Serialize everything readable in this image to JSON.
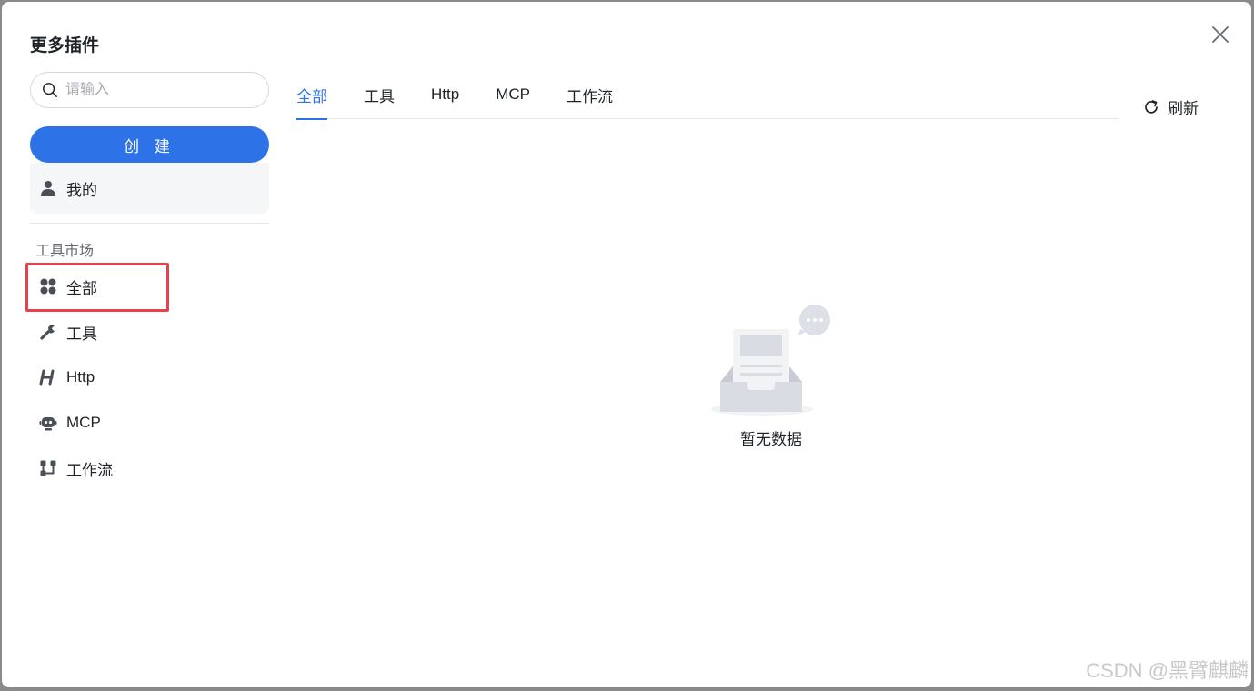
{
  "dialog": {
    "title": "更多插件"
  },
  "sidebar": {
    "search_placeholder": "请输入",
    "create_label": "创 建",
    "mine_label": "我的",
    "section_label": "工具市场",
    "items": [
      {
        "label": "全部",
        "icon": "grid-icon"
      },
      {
        "label": "工具",
        "icon": "wrench-icon"
      },
      {
        "label": "Http",
        "icon": "http-icon"
      },
      {
        "label": "MCP",
        "icon": "robot-icon"
      },
      {
        "label": "工作流",
        "icon": "workflow-icon"
      }
    ]
  },
  "tabs": [
    {
      "label": "全部",
      "active": true
    },
    {
      "label": "工具",
      "active": false
    },
    {
      "label": "Http",
      "active": false
    },
    {
      "label": "MCP",
      "active": false
    },
    {
      "label": "工作流",
      "active": false
    }
  ],
  "refresh_label": "刷新",
  "empty_text": "暂无数据",
  "watermark": "CSDN @黑臂麒麟",
  "colors": {
    "accent": "#2e72e8",
    "highlight": "#e8414b"
  }
}
